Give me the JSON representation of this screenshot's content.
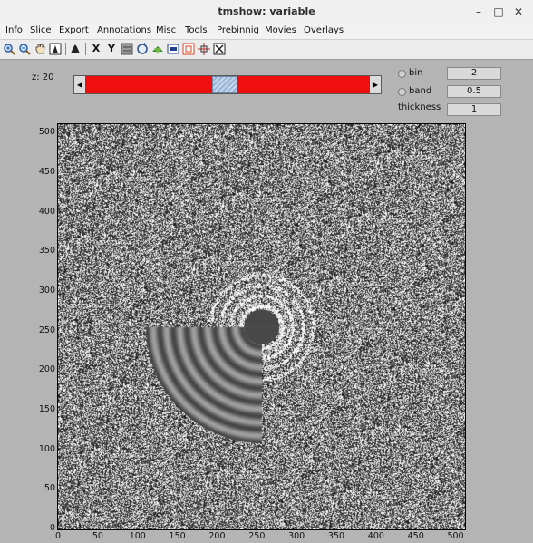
{
  "window": {
    "title": "tmshow: variable",
    "buttons": [
      "–",
      "□",
      "✕"
    ]
  },
  "menu": [
    "Info",
    "Slice",
    "Export",
    "Annotations",
    "Misc",
    "Tools",
    "Prebinnig",
    "Movies",
    "Overlays"
  ],
  "toolbar": {
    "icons": [
      "zoom-in-icon",
      "zoom-out-icon",
      "pan-hand-icon",
      "picker-icon",
      "histogram-icon",
      "x-axis-icon",
      "y-axis-icon",
      "grid-icon",
      "rotate-icon",
      "arrows-icon",
      "colorbar-icon",
      "region-icon",
      "crosshair-icon",
      "fit-icon"
    ],
    "x_label": "X",
    "y_label": "Y"
  },
  "slice": {
    "z_label": "z: 20",
    "slider_value": 0.49,
    "slider_color": "#ef0f0f"
  },
  "options": {
    "bin_label": "bin",
    "bin_value": "2",
    "band_label": "band",
    "band_value": "0.5",
    "thickness_label": "thickness",
    "thickness_value": "1"
  },
  "chart_data": {
    "type": "heatmap",
    "xlim": [
      0,
      512
    ],
    "ylim": [
      0,
      512
    ],
    "x_ticks": [
      "0",
      "50",
      "100",
      "150",
      "200",
      "250",
      "300",
      "350",
      "400",
      "450",
      "500"
    ],
    "y_ticks": [
      "0",
      "50",
      "100",
      "150",
      "200",
      "250",
      "300",
      "350",
      "400",
      "450",
      "500"
    ],
    "center": [
      256,
      256
    ],
    "inner_disk_radius": 22,
    "quadrant_radius": 146,
    "grid": false
  }
}
